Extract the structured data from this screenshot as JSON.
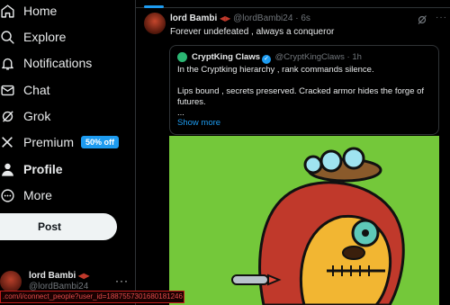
{
  "nav": {
    "items": [
      {
        "label": "Home",
        "icon": "home-icon"
      },
      {
        "label": "Explore",
        "icon": "search-icon"
      },
      {
        "label": "Notifications",
        "icon": "bell-icon"
      },
      {
        "label": "Chat",
        "icon": "mail-icon"
      },
      {
        "label": "Grok",
        "icon": "grok-icon"
      },
      {
        "label": "Premium",
        "icon": "x-logo-icon",
        "badge": "50% off"
      },
      {
        "label": "Profile",
        "icon": "person-icon"
      },
      {
        "label": "More",
        "icon": "more-circle-icon"
      }
    ],
    "post_label": "Post"
  },
  "account": {
    "name": "lord Bambi",
    "handle": "@lordBambi24",
    "more": "···"
  },
  "tweet": {
    "author": "lord Bambi",
    "handle": "@lordBambi24",
    "time": "6s",
    "text": "Forever undefeated , always  a conqueror",
    "more": "···"
  },
  "quote": {
    "author": "CryptKing Claws",
    "handle": "@CryptKingClaws",
    "time": "1h",
    "line1": "In the Cryptking hierarchy , rank commands silence.",
    "line2": "Lips bound , secrets preserved. Cracked armor hides the forge of",
    "line3": "futures.",
    "line4": "...",
    "show_more": "Show more"
  },
  "status_url": ".com/i/connect_people?user_id=1887557301680181246",
  "colors": {
    "accent": "#1d9bf0",
    "background": "#000000",
    "media_green": "#74c83a",
    "status_red": "#c21b1b"
  }
}
